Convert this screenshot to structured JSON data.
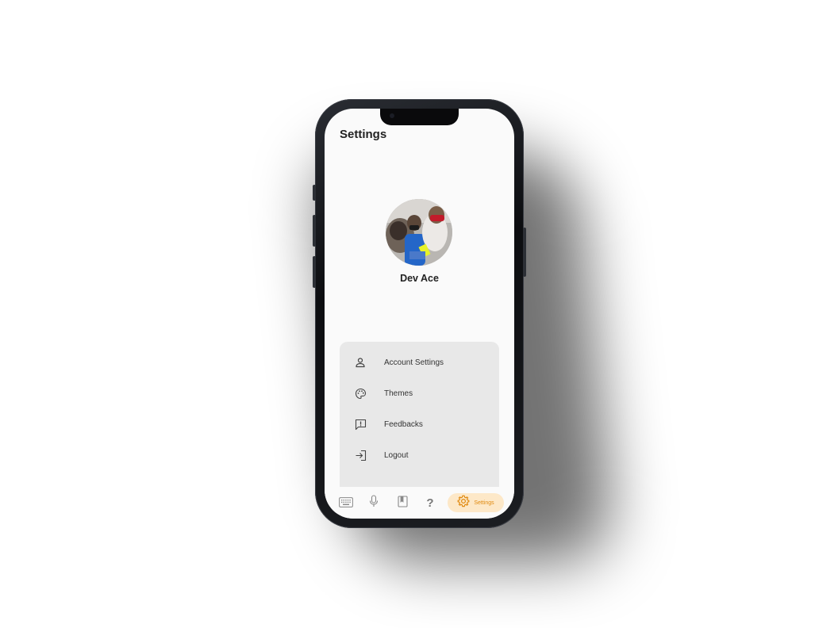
{
  "header": {
    "title": "Settings"
  },
  "profile": {
    "name": "Dev Ace"
  },
  "menu": {
    "items": [
      {
        "label": "Account Settings",
        "icon": "person-icon"
      },
      {
        "label": "Themes",
        "icon": "palette-icon"
      },
      {
        "label": "Feedbacks",
        "icon": "feedback-icon"
      },
      {
        "label": "Logout",
        "icon": "logout-icon"
      }
    ]
  },
  "bottom_nav": {
    "items": [
      {
        "icon": "keyboard-icon"
      },
      {
        "icon": "microphone-icon"
      },
      {
        "icon": "book-icon"
      },
      {
        "icon": "help-icon",
        "glyph": "?"
      },
      {
        "icon": "gear-icon",
        "label": "Settings",
        "active": true
      }
    ]
  },
  "colors": {
    "accent": "#e08a10",
    "accent_bg": "#fde8c8",
    "menu_bg": "#e8e8e8",
    "screen_bg": "#fafafa"
  }
}
